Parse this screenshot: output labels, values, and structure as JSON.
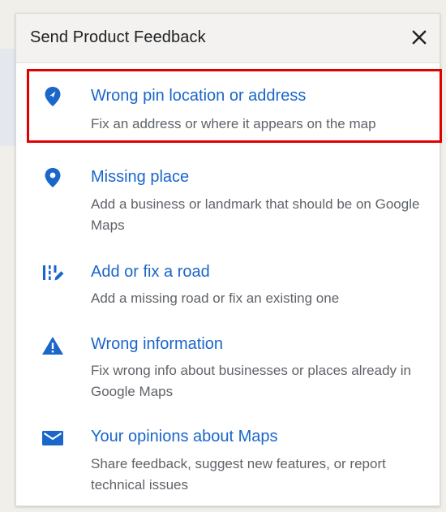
{
  "dialog": {
    "title": "Send Product Feedback",
    "close_icon": "close-icon"
  },
  "options": [
    {
      "icon": "location-pin-icon",
      "title": "Wrong pin location or address",
      "description": "Fix an address or where it appears on the map",
      "highlighted": true
    },
    {
      "icon": "location-pin-icon",
      "title": "Missing place",
      "description": "Add a business or landmark that should be on Google Maps"
    },
    {
      "icon": "road-edit-icon",
      "title": "Add or fix a road",
      "description": "Add a missing road or fix an existing one"
    },
    {
      "icon": "warning-icon",
      "title": "Wrong information",
      "description": "Fix wrong info about businesses or places already in Google Maps"
    },
    {
      "icon": "mail-icon",
      "title": "Your opinions about Maps",
      "description": "Share feedback, suggest new features, or report technical issues"
    }
  ],
  "colors": {
    "accent_blue": "#1a66c9",
    "highlight_red": "#e00000",
    "text_secondary": "#5f6368"
  }
}
